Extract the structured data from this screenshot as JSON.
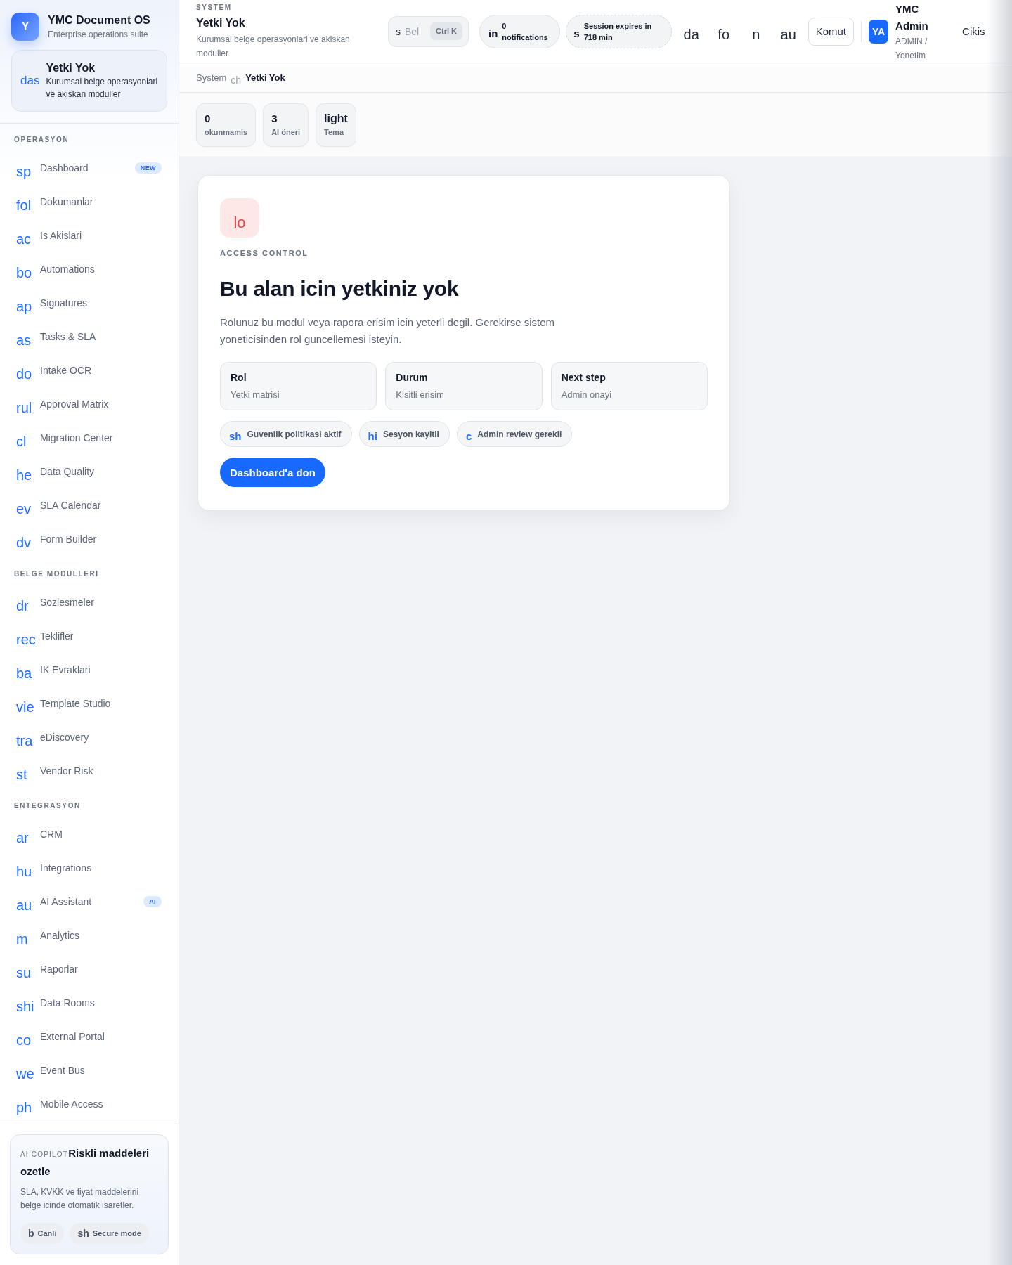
{
  "sidebar": {
    "brand": {
      "logo": "Y",
      "name": "YMC Document OS",
      "tagline": "Enterprise operations suite"
    },
    "context": {
      "icon": "das",
      "title": "Yetki Yok",
      "description": "Kurumsal belge operasyonlari ve akiskan moduller"
    },
    "sections": [
      {
        "title": "OPERASYON",
        "items": [
          {
            "icon": "sp",
            "label": "Dashboard",
            "badge": "NEW"
          },
          {
            "icon": "fol",
            "label": "Dokumanlar"
          },
          {
            "icon": "ac",
            "label": "Is Akislari"
          },
          {
            "icon": "bo",
            "label": "Automations"
          },
          {
            "icon": "ap",
            "label": "Signatures"
          },
          {
            "icon": "as",
            "label": "Tasks & SLA"
          },
          {
            "icon": "do",
            "label": "Intake OCR"
          },
          {
            "icon": "rul",
            "label": "Approval Matrix"
          },
          {
            "icon": "cl",
            "label": "Migration Center"
          },
          {
            "icon": "he",
            "label": "Data Quality"
          },
          {
            "icon": "ev",
            "label": "SLA Calendar"
          },
          {
            "icon": "dv",
            "label": "Form Builder"
          }
        ]
      },
      {
        "title": "BELGE MODULLERI",
        "items": [
          {
            "icon": "dr",
            "label": "Sozlesmeler"
          },
          {
            "icon": "rec",
            "label": "Teklifler"
          },
          {
            "icon": "ba",
            "label": "IK Evraklari"
          },
          {
            "icon": "vie",
            "label": "Template Studio"
          },
          {
            "icon": "tra",
            "label": "eDiscovery"
          },
          {
            "icon": "st",
            "label": "Vendor Risk"
          }
        ]
      },
      {
        "title": "ENTEGRASYON",
        "items": [
          {
            "icon": "ar",
            "label": "CRM"
          },
          {
            "icon": "hu",
            "label": "Integrations"
          },
          {
            "icon": "au",
            "label": "AI Assistant",
            "badge": "AI"
          },
          {
            "icon": "m",
            "label": "Analytics"
          },
          {
            "icon": "su",
            "label": "Raporlar"
          },
          {
            "icon": "shi",
            "label": "Data Rooms"
          },
          {
            "icon": "co",
            "label": "External Portal"
          },
          {
            "icon": "we",
            "label": "Event Bus"
          },
          {
            "icon": "ph",
            "label": "Mobile Access"
          }
        ]
      }
    ],
    "copilot": {
      "label": "AI COPİLOT",
      "title": "Riskli maddeleri ozetle",
      "description": "SLA, KVKK ve fiyat maddelerini belge icinde otomatik isaretler.",
      "chips": [
        {
          "icon": "b",
          "label": "Canli"
        },
        {
          "icon": "sh",
          "label": "Secure mode"
        }
      ]
    }
  },
  "header": {
    "eyebrow": "SYSTEM",
    "title": "Yetki Yok",
    "description": "Kurumsal belge operasyonlari ve akiskan moduller",
    "search": {
      "icon": "s",
      "placeholder": "Bel",
      "shortcut": "Ctrl K"
    },
    "notifications": {
      "icon": "in",
      "text": "0 notifications"
    },
    "session": {
      "icon": "s",
      "text": "Session expires in 718 min"
    },
    "icon_buttons": [
      "da",
      "fo",
      "n",
      "au"
    ],
    "command_button": "Komut",
    "user": {
      "initials": "YA",
      "name": "YMC Admin",
      "role": "ADMIN / Yonetim"
    },
    "logout": "Cikis"
  },
  "breadcrumb": {
    "items": [
      "System",
      "Yetki Yok"
    ],
    "separator": "ch"
  },
  "stats": [
    {
      "value": "0",
      "label": "okunmamis"
    },
    {
      "value": "3",
      "label": "AI öneri"
    },
    {
      "value": "light",
      "label": "Tema"
    }
  ],
  "card": {
    "icon": "lo",
    "eyebrow": "ACCESS CONTROL",
    "title": "Bu alan icin yetkiniz yok",
    "description": "Rolunuz bu modul veya rapora erisim icin yeterli degil. Gerekirse sistem yoneticisinden rol guncellemesi isteyin.",
    "facts": [
      {
        "label": "Rol",
        "value": "Yetki matrisi"
      },
      {
        "label": "Durum",
        "value": "Kisitli erisim"
      },
      {
        "label": "Next step",
        "value": "Admin onayi"
      }
    ],
    "tags": [
      {
        "icon": "sh",
        "label": "Guvenlik politikasi aktif"
      },
      {
        "icon": "hi",
        "label": "Sesyon kayitli"
      },
      {
        "icon": "c",
        "label": "Admin review gerekli"
      }
    ],
    "button": "Dashboard'a don"
  }
}
